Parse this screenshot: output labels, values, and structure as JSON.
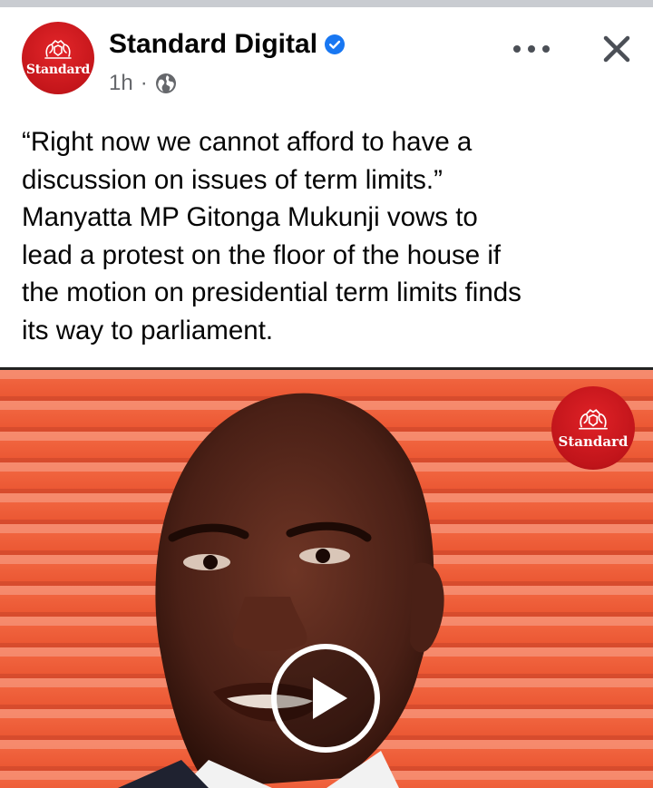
{
  "post": {
    "page_name": "Standard Digital",
    "timestamp": "1h",
    "separator": "·",
    "audience_icon": "globe-icon",
    "verified_icon": "verified-badge-icon",
    "text_lines": [
      "“Right now we cannot afford to have a",
      "discussion on issues of term limits.”",
      "Manyatta MP Gitonga Mukunji vows to",
      "lead a protest on the floor of the house if",
      "the motion on presidential term limits finds",
      "its way to parliament."
    ]
  },
  "avatar": {
    "logo_text": "Standard"
  },
  "video": {
    "watermark_text": "Standard",
    "play_icon": "play-icon"
  },
  "colors": {
    "brand_red": "#c5161b",
    "verified_blue": "#1877f2",
    "shutter_orange": "#ee5a34"
  }
}
